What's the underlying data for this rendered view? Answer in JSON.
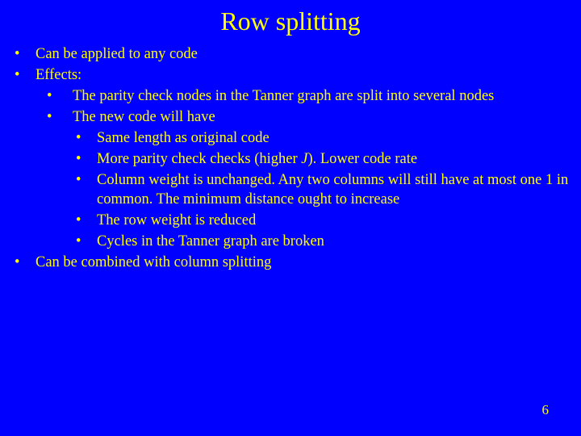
{
  "title": "Row splitting",
  "l1_1": "Can be applied to any code",
  "l1_2": "Effects:",
  "l2_1": "The parity check nodes in the Tanner graph are split into several nodes",
  "l2_2": "The new code will have",
  "l3_1": "Same length as  original code",
  "l3_2_prefix": "More parity check checks  (higher ",
  "l3_2_italic": "J",
  "l3_2_suffix": "). Lower code rate",
  "l3_3": "Column weight is unchanged. Any two columns will still have at most one 1 in common. The minimum distance ought to increase",
  "l3_4": "The row weight  is reduced",
  "l3_5": "Cycles in the Tanner graph are broken",
  "l1_3": "Can be combined with column splitting",
  "page_number": "6",
  "bullet_char": "•"
}
